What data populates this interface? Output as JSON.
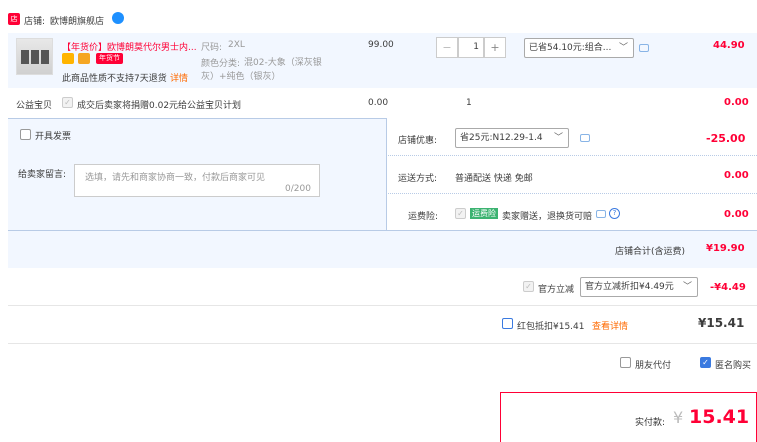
{
  "shop": {
    "label": "店铺:",
    "name": "欧博朗旗舰店"
  },
  "item": {
    "title": "【年货价】欧博朗莫代尔男士内...",
    "tag_festival": "年货节",
    "no_return_text": "此商品性质不支持7天退货",
    "details_link": "详情",
    "size_label": "尺码:",
    "size_value": "2XL",
    "color_label": "颜色分类:",
    "color_value": "混02-大象（深灰银灰）+纯色（银灰）",
    "price": "99.00",
    "quantity": "1",
    "discount_select": "已省54.10元:组合...",
    "subtotal": "44.90"
  },
  "charity": {
    "label": "公益宝贝",
    "text": "成交后卖家将捐赠0.02元给公益宝贝计划",
    "price": "0.00",
    "qty": "1",
    "subtotal": "0.00"
  },
  "invoice": {
    "label": "开具发票"
  },
  "shop_discount": {
    "label": "店铺优惠:",
    "select": "省25元:N12.29-1.4",
    "amount": "-25.00"
  },
  "buyer_msg": {
    "label": "给卖家留言:",
    "placeholder": "选填，请先和商家协商一致，付款后商家可见",
    "counter": "0/200"
  },
  "shipping": {
    "label": "运送方式:",
    "text": "普通配送 快递 免邮",
    "amount": "0.00"
  },
  "insurance": {
    "label": "运费险:",
    "tag": "运费险",
    "text": "卖家赠送，退换货可赔",
    "amount": "0.00"
  },
  "shop_total": {
    "label": "店铺合计(含运费)",
    "amount": "¥19.90"
  },
  "official": {
    "label": "官方立减",
    "select": "官方立减折扣¥4.49元",
    "amount": "-¥4.49"
  },
  "redpacket": {
    "label": "红包抵扣¥15.41",
    "link": "查看详情",
    "amount": "¥15.41"
  },
  "options": {
    "friend_pay": "朋友代付",
    "anonymous": "匿名购买"
  },
  "payment": {
    "label": "实付款:",
    "currency": "¥",
    "amount": "15.41"
  },
  "colors": {
    "accent": "#ff0036",
    "blue": "#3a7ae0"
  }
}
